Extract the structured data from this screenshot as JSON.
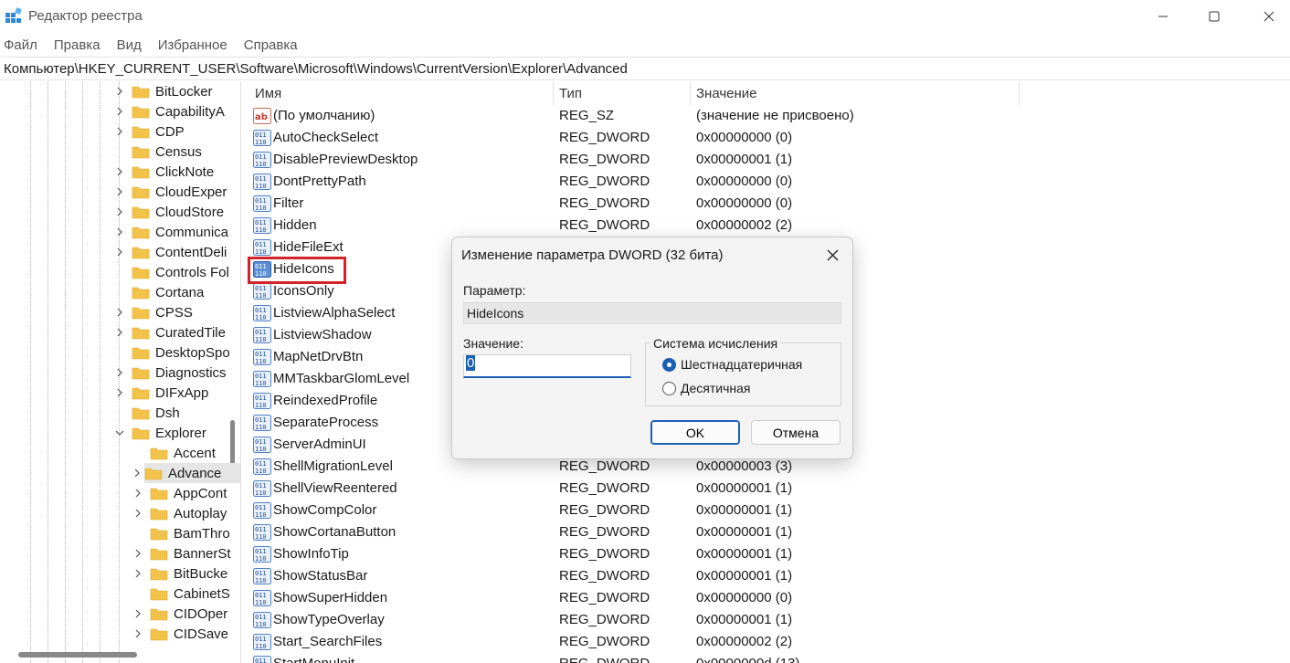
{
  "window": {
    "title": "Редактор реестра",
    "icon": "registry-editor-icon"
  },
  "menu": [
    "Файл",
    "Правка",
    "Вид",
    "Избранное",
    "Справка"
  ],
  "address": "Компьютер\\HKEY_CURRENT_USER\\Software\\Microsoft\\Windows\\CurrentVersion\\Explorer\\Advanced",
  "tree": {
    "items": [
      {
        "label": "BitLocker",
        "level": 1,
        "expander": "collapsed"
      },
      {
        "label": "CapabilityA",
        "level": 1,
        "expander": "collapsed"
      },
      {
        "label": "CDP",
        "level": 1,
        "expander": "collapsed"
      },
      {
        "label": "Census",
        "level": 1,
        "expander": "none"
      },
      {
        "label": "ClickNote",
        "level": 1,
        "expander": "collapsed"
      },
      {
        "label": "CloudExper",
        "level": 1,
        "expander": "collapsed"
      },
      {
        "label": "CloudStore",
        "level": 1,
        "expander": "collapsed"
      },
      {
        "label": "Communica",
        "level": 1,
        "expander": "collapsed"
      },
      {
        "label": "ContentDeli",
        "level": 1,
        "expander": "collapsed"
      },
      {
        "label": "Controls Fol",
        "level": 1,
        "expander": "none"
      },
      {
        "label": "Cortana",
        "level": 1,
        "expander": "none"
      },
      {
        "label": "CPSS",
        "level": 1,
        "expander": "collapsed"
      },
      {
        "label": "CuratedTile",
        "level": 1,
        "expander": "collapsed"
      },
      {
        "label": "DesktopSpo",
        "level": 1,
        "expander": "none"
      },
      {
        "label": "Diagnostics",
        "level": 1,
        "expander": "collapsed"
      },
      {
        "label": "DIFxApp",
        "level": 1,
        "expander": "collapsed"
      },
      {
        "label": "Dsh",
        "level": 1,
        "expander": "none"
      },
      {
        "label": "Explorer",
        "level": 1,
        "expander": "expanded"
      },
      {
        "label": "Accent",
        "level": 2,
        "expander": "none"
      },
      {
        "label": "Advance",
        "level": 2,
        "expander": "collapsed",
        "selected": true
      },
      {
        "label": "AppCont",
        "level": 2,
        "expander": "collapsed"
      },
      {
        "label": "Autoplay",
        "level": 2,
        "expander": "collapsed"
      },
      {
        "label": "BamThro",
        "level": 2,
        "expander": "none"
      },
      {
        "label": "BannerSt",
        "level": 2,
        "expander": "collapsed"
      },
      {
        "label": "BitBucke",
        "level": 2,
        "expander": "collapsed"
      },
      {
        "label": "CabinetS",
        "level": 2,
        "expander": "none"
      },
      {
        "label": "CIDOper",
        "level": 2,
        "expander": "collapsed"
      },
      {
        "label": "CIDSave",
        "level": 2,
        "expander": "collapsed"
      }
    ]
  },
  "columns": {
    "name": "Имя",
    "type": "Тип",
    "value": "Значение"
  },
  "rows": [
    {
      "name": "(По умолчанию)",
      "type": "REG_SZ",
      "value": "(значение не присвоено)",
      "icon": "string-value-icon"
    },
    {
      "name": "AutoCheckSelect",
      "type": "REG_DWORD",
      "value": "0x00000000 (0)",
      "icon": "dword-value-icon"
    },
    {
      "name": "DisablePreviewDesktop",
      "type": "REG_DWORD",
      "value": "0x00000001 (1)",
      "icon": "dword-value-icon"
    },
    {
      "name": "DontPrettyPath",
      "type": "REG_DWORD",
      "value": "0x00000000 (0)",
      "icon": "dword-value-icon"
    },
    {
      "name": "Filter",
      "type": "REG_DWORD",
      "value": "0x00000000 (0)",
      "icon": "dword-value-icon"
    },
    {
      "name": "Hidden",
      "type": "REG_DWORD",
      "value": "0x00000002 (2)",
      "icon": "dword-value-icon"
    },
    {
      "name": "HideFileExt",
      "type": "",
      "value": "",
      "icon": "dword-value-icon"
    },
    {
      "name": "HideIcons",
      "type": "",
      "value": "",
      "icon": "dword-value-icon",
      "highlighted": true
    },
    {
      "name": "IconsOnly",
      "type": "",
      "value": "",
      "icon": "dword-value-icon"
    },
    {
      "name": "ListviewAlphaSelect",
      "type": "",
      "value": "",
      "icon": "dword-value-icon"
    },
    {
      "name": "ListviewShadow",
      "type": "",
      "value": "",
      "icon": "dword-value-icon"
    },
    {
      "name": "MapNetDrvBtn",
      "type": "",
      "value": "",
      "icon": "dword-value-icon"
    },
    {
      "name": "MMTaskbarGlomLevel",
      "type": "",
      "value": "",
      "icon": "dword-value-icon"
    },
    {
      "name": "ReindexedProfile",
      "type": "",
      "value": "",
      "icon": "dword-value-icon"
    },
    {
      "name": "SeparateProcess",
      "type": "",
      "value": "",
      "icon": "dword-value-icon"
    },
    {
      "name": "ServerAdminUI",
      "type": "",
      "value": "",
      "icon": "dword-value-icon"
    },
    {
      "name": "ShellMigrationLevel",
      "type": "REG_DWORD",
      "value": "0x00000003 (3)",
      "icon": "dword-value-icon"
    },
    {
      "name": "ShellViewReentered",
      "type": "REG_DWORD",
      "value": "0x00000001 (1)",
      "icon": "dword-value-icon"
    },
    {
      "name": "ShowCompColor",
      "type": "REG_DWORD",
      "value": "0x00000001 (1)",
      "icon": "dword-value-icon"
    },
    {
      "name": "ShowCortanaButton",
      "type": "REG_DWORD",
      "value": "0x00000001 (1)",
      "icon": "dword-value-icon"
    },
    {
      "name": "ShowInfoTip",
      "type": "REG_DWORD",
      "value": "0x00000001 (1)",
      "icon": "dword-value-icon"
    },
    {
      "name": "ShowStatusBar",
      "type": "REG_DWORD",
      "value": "0x00000001 (1)",
      "icon": "dword-value-icon"
    },
    {
      "name": "ShowSuperHidden",
      "type": "REG_DWORD",
      "value": "0x00000000 (0)",
      "icon": "dword-value-icon"
    },
    {
      "name": "ShowTypeOverlay",
      "type": "REG_DWORD",
      "value": "0x00000001 (1)",
      "icon": "dword-value-icon"
    },
    {
      "name": "Start_SearchFiles",
      "type": "REG_DWORD",
      "value": "0x00000002 (2)",
      "icon": "dword-value-icon"
    },
    {
      "name": "StartMenuInit",
      "type": "REG_DWORD",
      "value": "0x0000000d (13)",
      "icon": "dword-value-icon"
    }
  ],
  "dialog": {
    "title": "Изменение параметра DWORD (32 бита)",
    "param_label": "Параметр:",
    "param_value": "HideIcons",
    "value_label": "Значение:",
    "value_input": "0",
    "base_group": "Система исчисления",
    "base_hex": "Шестнадцатеричная",
    "base_dec": "Десятичная",
    "selected_base": "hex",
    "ok": "OK",
    "cancel": "Отмена"
  },
  "colors": {
    "accent": "#1a5fb4",
    "highlight_box": "#d2232a",
    "folder": "#f3c24a"
  }
}
